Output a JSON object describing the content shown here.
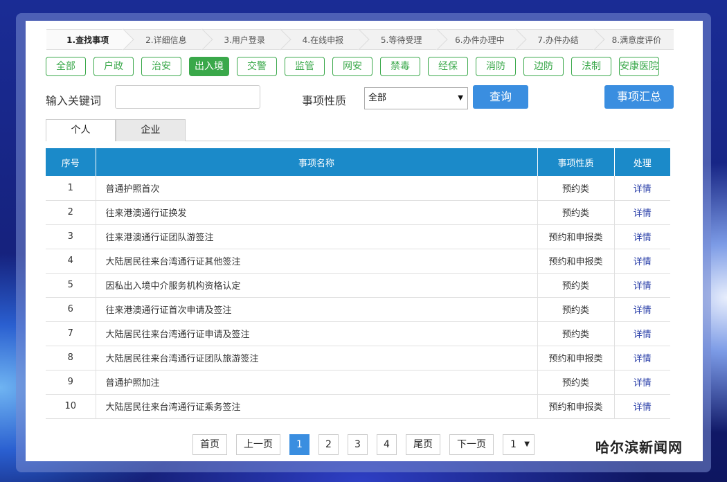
{
  "steps": [
    "1.查找事项",
    "2.详细信息",
    "3.用户登录",
    "4.在线申报",
    "5.等待受理",
    "6.办件办理中",
    "7.办件办结",
    "8.满意度评价"
  ],
  "categories": [
    "全部",
    "户政",
    "治安",
    "出入境",
    "交警",
    "监管",
    "网安",
    "禁毒",
    "经保",
    "消防",
    "边防",
    "法制",
    "安康医院"
  ],
  "active_category": "出入境",
  "search": {
    "keyword_label": "输入关键词",
    "keyword_value": "",
    "nature_label": "事项性质",
    "nature_value": "全部",
    "query_button": "查询",
    "summary_button": "事项汇总"
  },
  "tabs": [
    "个人",
    "企业"
  ],
  "table": {
    "headers": [
      "序号",
      "事项名称",
      "事项性质",
      "处理"
    ],
    "rows": [
      {
        "no": "1",
        "name": "普通护照首次",
        "nature": "预约类",
        "action": "详情"
      },
      {
        "no": "2",
        "name": "往来港澳通行证换发",
        "nature": "预约类",
        "action": "详情"
      },
      {
        "no": "3",
        "name": "往来港澳通行证团队游签注",
        "nature": "预约和申报类",
        "action": "详情"
      },
      {
        "no": "4",
        "name": "大陆居民往来台湾通行证其他签注",
        "nature": "预约和申报类",
        "action": "详情"
      },
      {
        "no": "5",
        "name": "因私出入境中介服务机构资格认定",
        "nature": "预约类",
        "action": "详情"
      },
      {
        "no": "6",
        "name": "往来港澳通行证首次申请及签注",
        "nature": "预约类",
        "action": "详情"
      },
      {
        "no": "7",
        "name": "大陆居民往来台湾通行证申请及签注",
        "nature": "预约类",
        "action": "详情"
      },
      {
        "no": "8",
        "name": "大陆居民往来台湾通行证团队旅游签注",
        "nature": "预约和申报类",
        "action": "详情"
      },
      {
        "no": "9",
        "name": "普通护照加注",
        "nature": "预约类",
        "action": "详情"
      },
      {
        "no": "10",
        "name": "大陆居民往来台湾通行证乘务签注",
        "nature": "预约和申报类",
        "action": "详情"
      }
    ]
  },
  "pager": {
    "first": "首页",
    "prev": "上一页",
    "pages": [
      "1",
      "2",
      "3",
      "4"
    ],
    "current": "1",
    "last": "尾页",
    "next": "下一页",
    "jump_value": "1"
  },
  "watermark": "哈尔滨新闻网",
  "colors": {
    "green": "#3aa84a",
    "blue": "#3a8ee0",
    "header": "#1b8ac9",
    "link": "#2a3fa8"
  }
}
